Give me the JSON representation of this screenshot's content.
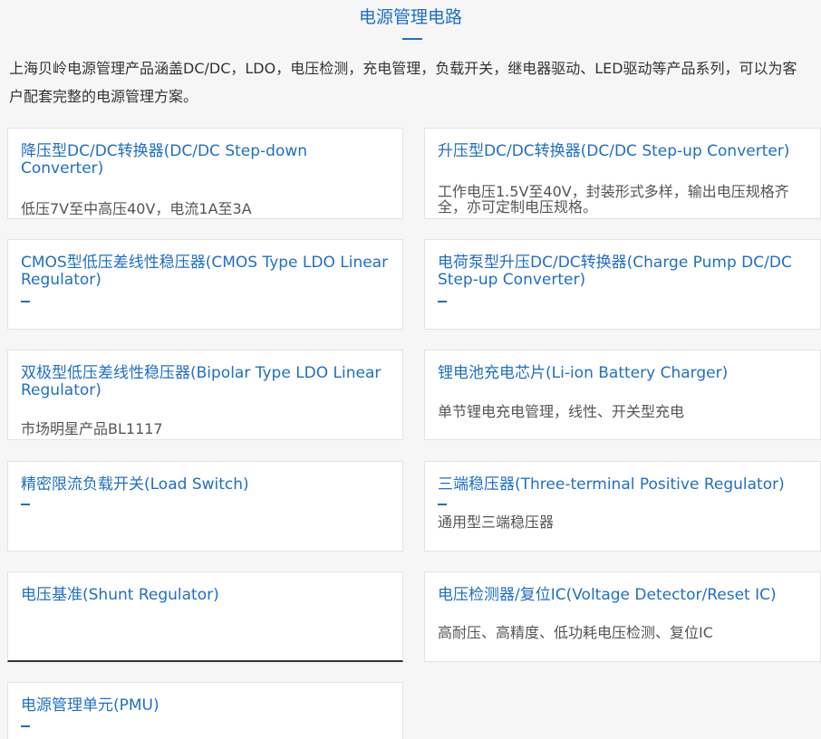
{
  "header": {
    "title": "电源管理电路"
  },
  "intro": {
    "text": "上海贝岭电源管理产品涵盖DC/DC，LDO，电压检测，充电管理，负载开关，继电器驱动、LED驱动等产品系列，可以为客户配套完整的电源管理方案。"
  },
  "cards": [
    {
      "title": "降压型DC/DC转换器(DC/DC Step-down Converter)",
      "desc": "低压7V至中高压40V，电流1A至3A"
    },
    {
      "title": "升压型DC/DC转换器(DC/DC Step-up Converter)",
      "desc": "工作电压1.5V至40V，封装形式多样，输出电压规格齐全，亦可定制电压规格。"
    },
    {
      "title": "CMOS型低压差线性稳压器(CMOS Type LDO Linear Regulator)",
      "desc": ""
    },
    {
      "title": "电荷泵型升压DC/DC转换器(Charge Pump DC/DC Step-up Converter)",
      "desc": ""
    },
    {
      "title": "双极型低压差线性稳压器(Bipolar Type LDO Linear Regulator)",
      "desc": "市场明星产品BL1117"
    },
    {
      "title": "锂电池充电芯片(Li-ion Battery Charger)",
      "desc": "单节锂电充电管理，线性、开关型充电"
    },
    {
      "title": "精密限流负载开关(Load Switch)",
      "desc": ""
    },
    {
      "title": "三端稳压器(Three-terminal Positive Regulator)",
      "desc": "通用型三端稳压器"
    },
    {
      "title": "电压基准(Shunt Regulator)",
      "desc": ""
    },
    {
      "title": "电压检测器/复位IC(Voltage Detector/Reset IC)",
      "desc": "高耐压、高精度、低功耗电压检测、复位IC"
    },
    {
      "title": "电源管理单元(PMU)",
      "desc": ""
    }
  ]
}
